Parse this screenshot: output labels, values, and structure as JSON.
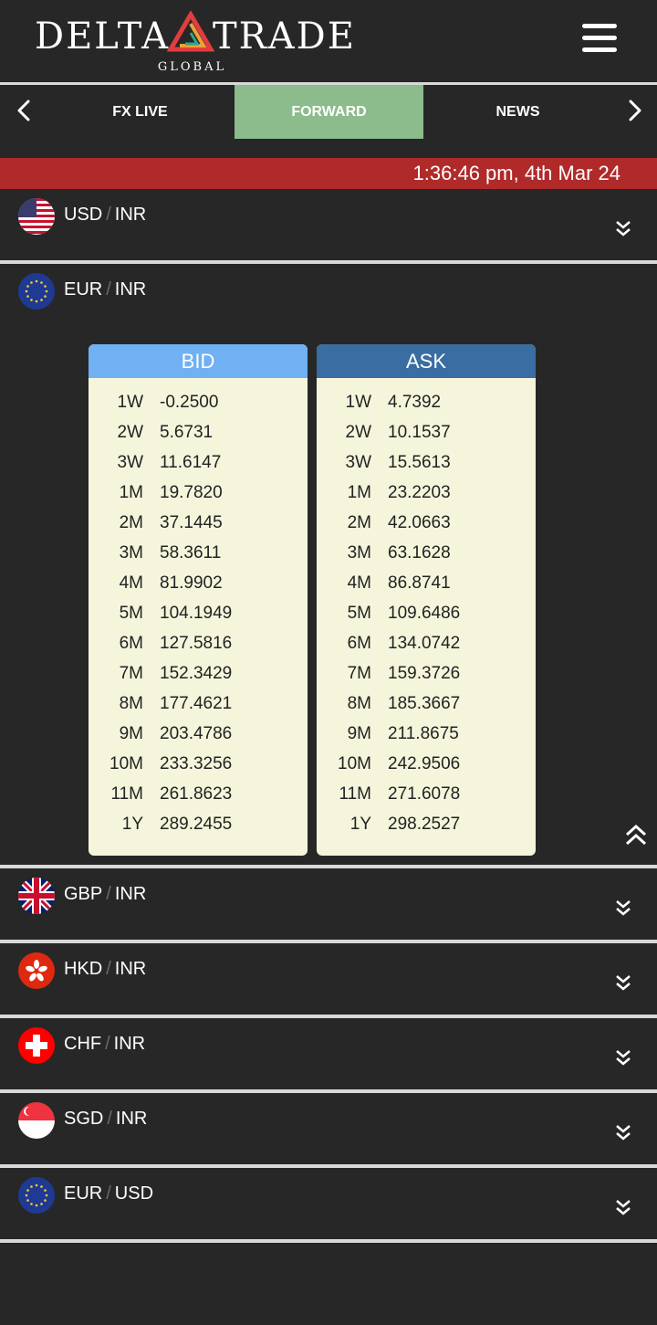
{
  "header": {
    "brand_left": "DELTA",
    "brand_right": "TRADE",
    "brand_sub": "GLOBAL",
    "menu_icon": "hamburger-menu-icon"
  },
  "tabs": [
    {
      "label": "FX LIVE",
      "active": false
    },
    {
      "label": "FORWARD",
      "active": true
    },
    {
      "label": "NEWS",
      "active": false
    }
  ],
  "timestamp": "1:36:46 pm, 4th Mar 24",
  "pairs": [
    {
      "base": "USD",
      "quote": "INR",
      "flag": "usa-flag",
      "expanded": false
    },
    {
      "base": "EUR",
      "quote": "INR",
      "flag": "eu-flag",
      "expanded": true
    },
    {
      "base": "GBP",
      "quote": "INR",
      "flag": "uk-flag",
      "expanded": false
    },
    {
      "base": "HKD",
      "quote": "INR",
      "flag": "hong-kong-flag",
      "expanded": false
    },
    {
      "base": "CHF",
      "quote": "INR",
      "flag": "switzerland-flag",
      "expanded": false
    },
    {
      "base": "SGD",
      "quote": "INR",
      "flag": "singapore-flag",
      "expanded": false
    },
    {
      "base": "EUR",
      "quote": "USD",
      "flag": "eu-flag",
      "expanded": false
    }
  ],
  "bid": {
    "title": "BID",
    "rows": [
      {
        "tenor": "1W",
        "value": "-0.2500"
      },
      {
        "tenor": "2W",
        "value": "5.6731"
      },
      {
        "tenor": "3W",
        "value": "11.6147"
      },
      {
        "tenor": "1M",
        "value": "19.7820"
      },
      {
        "tenor": "2M",
        "value": "37.1445"
      },
      {
        "tenor": "3M",
        "value": "58.3611"
      },
      {
        "tenor": "4M",
        "value": "81.9902"
      },
      {
        "tenor": "5M",
        "value": "104.1949"
      },
      {
        "tenor": "6M",
        "value": "127.5816"
      },
      {
        "tenor": "7M",
        "value": "152.3429"
      },
      {
        "tenor": "8M",
        "value": "177.4621"
      },
      {
        "tenor": "9M",
        "value": "203.4786"
      },
      {
        "tenor": "10M",
        "value": "233.3256"
      },
      {
        "tenor": "11M",
        "value": "261.8623"
      },
      {
        "tenor": "1Y",
        "value": "289.2455"
      }
    ]
  },
  "ask": {
    "title": "ASK",
    "rows": [
      {
        "tenor": "1W",
        "value": "4.7392"
      },
      {
        "tenor": "2W",
        "value": "10.1537"
      },
      {
        "tenor": "3W",
        "value": "15.5613"
      },
      {
        "tenor": "1M",
        "value": "23.2203"
      },
      {
        "tenor": "2M",
        "value": "42.0663"
      },
      {
        "tenor": "3M",
        "value": "63.1628"
      },
      {
        "tenor": "4M",
        "value": "86.8741"
      },
      {
        "tenor": "5M",
        "value": "109.6486"
      },
      {
        "tenor": "6M",
        "value": "134.0742"
      },
      {
        "tenor": "7M",
        "value": "159.3726"
      },
      {
        "tenor": "8M",
        "value": "185.3667"
      },
      {
        "tenor": "9M",
        "value": "211.8675"
      },
      {
        "tenor": "10M",
        "value": "242.9506"
      },
      {
        "tenor": "11M",
        "value": "271.6078"
      },
      {
        "tenor": "1Y",
        "value": "298.2527"
      }
    ]
  },
  "colors": {
    "background": "#272727",
    "active_tab": "#8cbb8c",
    "time_bar": "#b02a2a",
    "bid_header": "#6fb1f2",
    "ask_header": "#3a6da1",
    "card_bg": "#f5f5dc"
  }
}
